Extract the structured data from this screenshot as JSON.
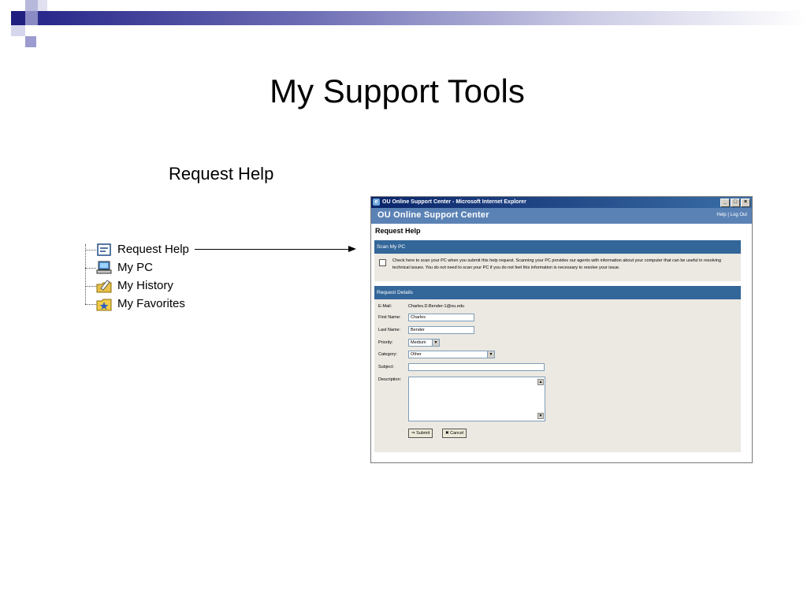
{
  "slide": {
    "title": "My Support Tools",
    "subtitle": "Request Help"
  },
  "tree": {
    "items": [
      {
        "label": "Request Help",
        "icon": "request-help-icon"
      },
      {
        "label": "My PC",
        "icon": "pc-icon"
      },
      {
        "label": "My History",
        "icon": "history-icon"
      },
      {
        "label": "My Favorites",
        "icon": "favorites-icon"
      }
    ]
  },
  "window": {
    "title": "OU Online Support Center - Microsoft Internet Explorer",
    "site_name": "OU Online Support Center",
    "help_link": "Help",
    "separator": "|",
    "logout_link": "Log Out",
    "page_title": "Request Help",
    "scan_section": {
      "title": "Scan My PC",
      "text": "Check here to scan your PC when you submit this help request. Scanning your PC provides our agents with information about your computer that can be useful in resolving technical issues. You do not need to scan your PC if you do not feel this information is necessary to resolve your issue."
    },
    "details_section": {
      "title": "Request Details",
      "email_label": "E-Mail:",
      "email_value": "Charles.D.Bender-1@ou.edu",
      "first_name_label": "First Name:",
      "first_name_value": "Charles",
      "last_name_label": "Last Name:",
      "last_name_value": "Bender",
      "priority_label": "Priority:",
      "priority_value": "Medium",
      "category_label": "Category:",
      "category_value": "Other",
      "subject_label": "Subject:",
      "subject_value": "",
      "description_label": "Description:",
      "submit_label": "Submit",
      "cancel_label": "Cancel"
    }
  },
  "colors": {
    "band_dark": "#2a2a8c",
    "band_light": "#9999cc",
    "site_header": "#5b82b5",
    "section_bar": "#336699"
  }
}
